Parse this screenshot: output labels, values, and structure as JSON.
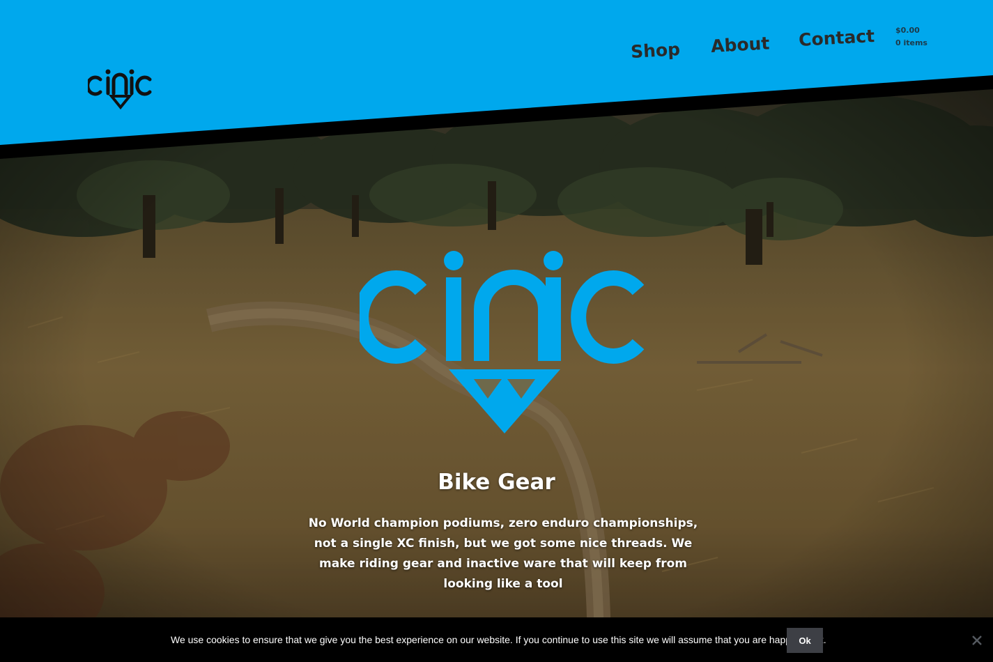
{
  "brand": {
    "name": "cinic",
    "color": "#00a8ed"
  },
  "nav": {
    "items": [
      {
        "label": "Shop"
      },
      {
        "label": "About"
      },
      {
        "label": "Contact"
      }
    ]
  },
  "cart": {
    "total": "$0.00",
    "items": "0 items"
  },
  "hero": {
    "title": "Bike Gear",
    "text": "No World champion podiums, zero enduro championships, not a single XC finish, but we got some nice threads. We make riding gear and inactive ware that will keep from looking like a tool"
  },
  "cookie": {
    "message": "We use cookies to ensure that we give you the best experience on our website. If you continue to use this site we will assume that you are happy with it.",
    "ok_label": "Ok",
    "close_icon": "close-icon"
  }
}
